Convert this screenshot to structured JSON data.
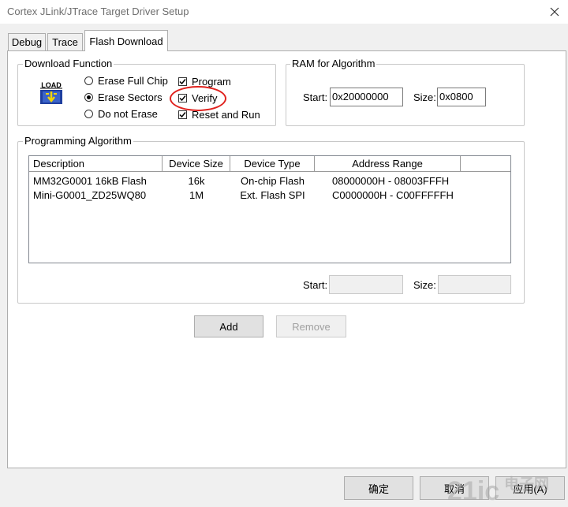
{
  "window": {
    "title": "Cortex JLink/JTrace Target Driver Setup"
  },
  "tabs": [
    {
      "label": "Debug"
    },
    {
      "label": "Trace"
    },
    {
      "label": "Flash Download"
    }
  ],
  "download_function": {
    "group_label": "Download Function",
    "icon_text": "LOAD",
    "options": [
      {
        "label": "Erase Full Chip",
        "selected": false
      },
      {
        "label": "Erase Sectors",
        "selected": true
      },
      {
        "label": "Do not Erase",
        "selected": false
      }
    ],
    "checks": [
      {
        "label": "Program",
        "checked": true
      },
      {
        "label": "Verify",
        "checked": true
      },
      {
        "label": "Reset and Run",
        "checked": true
      }
    ]
  },
  "ram": {
    "group_label": "RAM for Algorithm",
    "start_label": "Start:",
    "start_value": "0x20000000",
    "size_label": "Size:",
    "size_value": "0x0800"
  },
  "programming": {
    "group_label": "Programming Algorithm",
    "columns": [
      "Description",
      "Device Size",
      "Device Type",
      "Address Range"
    ],
    "rows": [
      {
        "description": "MM32G0001 16kB Flash",
        "size": "16k",
        "type": "On-chip Flash",
        "range": "08000000H - 08003FFFH"
      },
      {
        "description": "Mini-G0001_ZD25WQ80",
        "size": "1M",
        "type": "Ext. Flash SPI",
        "range": "C0000000H - C00FFFFFH"
      }
    ],
    "start_label": "Start:",
    "start_value": "",
    "size_label": "Size:",
    "size_value": ""
  },
  "buttons": {
    "add": "Add",
    "remove": "Remove"
  },
  "footer": {
    "ok": "确定",
    "cancel": "取消",
    "apply": "应用(A)"
  },
  "watermark": {
    "text1": "21ic",
    "text2": "电子网"
  },
  "colors": {
    "highlight_circle": "#e0221e",
    "icon_blue": "#1f3f9f",
    "icon_yellow": "#f2d300"
  }
}
